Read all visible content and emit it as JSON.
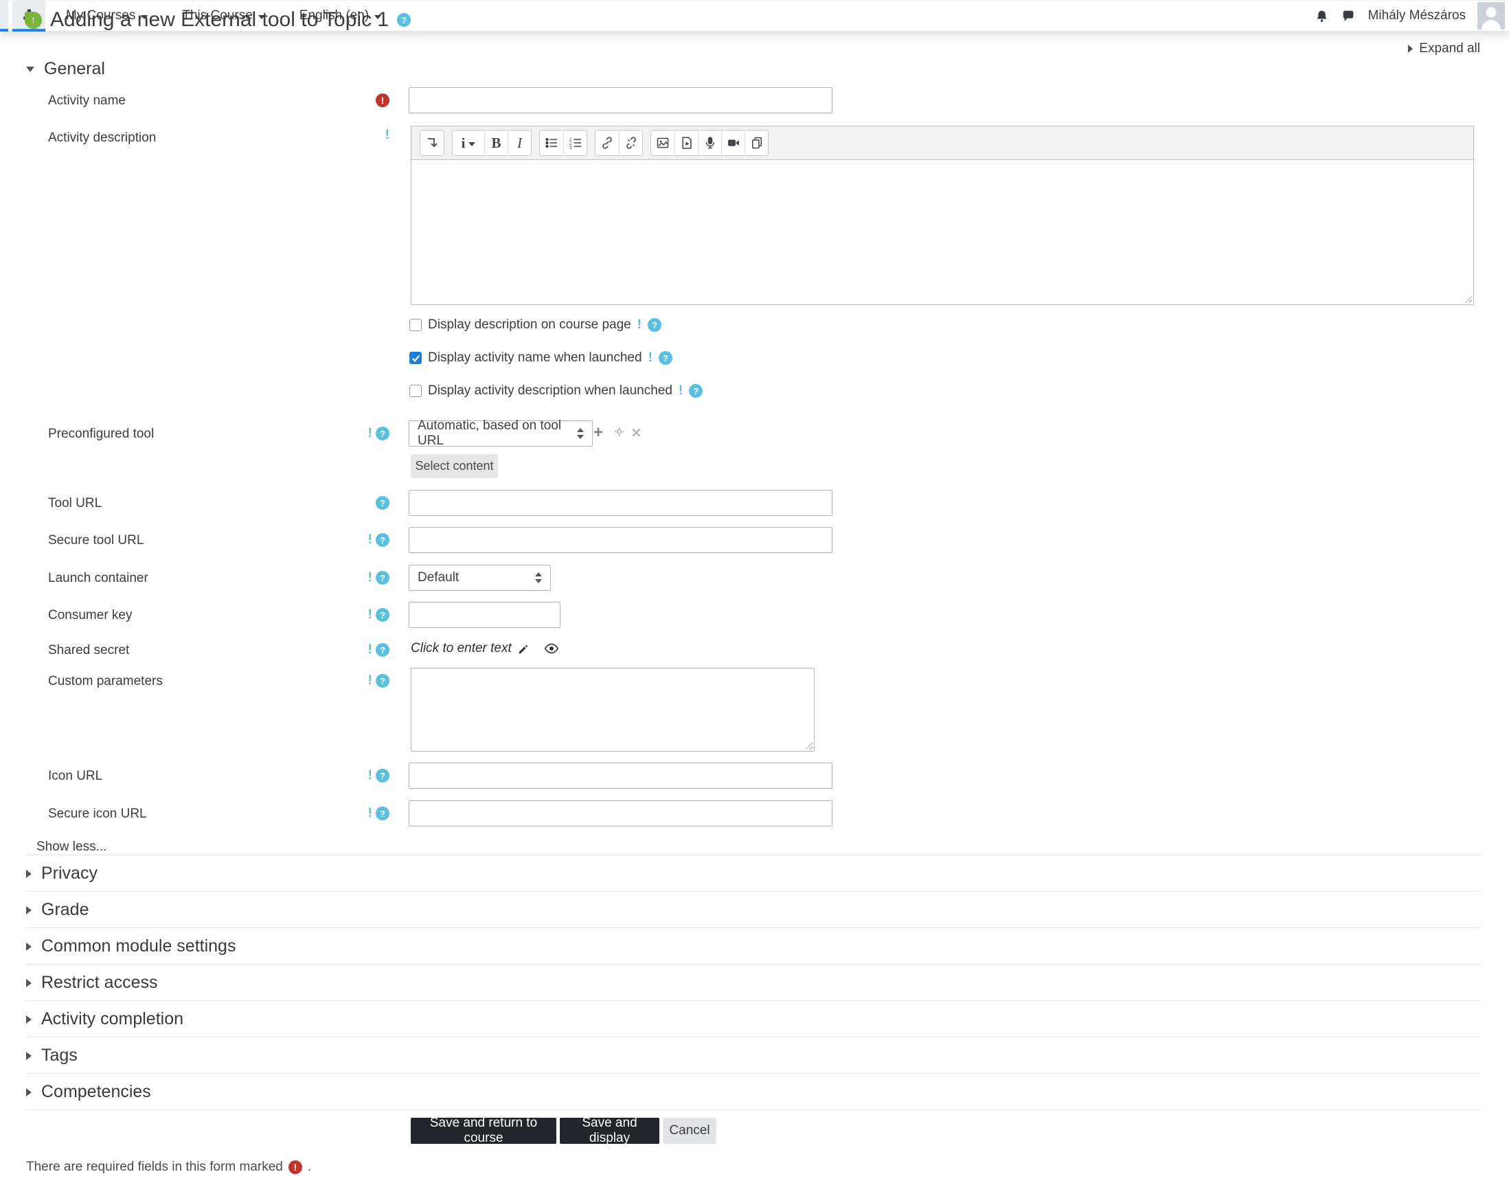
{
  "page": {
    "title": "Adding a new External tool to Topic 1",
    "expand_all": "Expand all",
    "show_less": "Show less...",
    "required_note": "There are required fields in this form marked",
    "required_note_period": "."
  },
  "navbar": {
    "menus": [
      {
        "label": "My Courses"
      },
      {
        "label": "This Course"
      },
      {
        "label": "English (en)"
      }
    ],
    "user_name": "Mihály Mészáros"
  },
  "general": {
    "heading": "General",
    "activity_name_label": "Activity name",
    "activity_description_label": "Activity description",
    "checkboxes": [
      {
        "label": "Display description on course page",
        "checked": false
      },
      {
        "label": "Display activity name when launched",
        "checked": true
      },
      {
        "label": "Display activity description when launched",
        "checked": false
      }
    ],
    "preconfigured_tool_label": "Preconfigured tool",
    "preconfigured_tool_value": "Automatic, based on tool URL",
    "select_content_label": "Select content",
    "tool_url_label": "Tool URL",
    "secure_tool_url_label": "Secure tool URL",
    "launch_container_label": "Launch container",
    "launch_container_value": "Default",
    "consumer_key_label": "Consumer key",
    "shared_secret_label": "Shared secret",
    "shared_secret_value": "Click to enter text",
    "custom_parameters_label": "Custom parameters",
    "icon_url_label": "Icon URL",
    "secure_icon_url_label": "Secure icon URL"
  },
  "editor": {
    "style_button_label": "i",
    "bold_button_label": "B",
    "italic_button_label": "I"
  },
  "sections": [
    {
      "label": "Privacy"
    },
    {
      "label": "Grade"
    },
    {
      "label": "Common module settings"
    },
    {
      "label": "Restrict access"
    },
    {
      "label": "Activity completion"
    },
    {
      "label": "Tags"
    },
    {
      "label": "Competencies"
    }
  ],
  "actions": {
    "save_return": "Save and return to course",
    "save_display": "Save and display",
    "cancel": "Cancel"
  },
  "colors": {
    "accent_blue": "#1e88e5",
    "help_blue": "#5bc0de",
    "required_red": "#c0342a",
    "tool_icon_green": "#7db33c",
    "button_dark": "#22262b"
  }
}
